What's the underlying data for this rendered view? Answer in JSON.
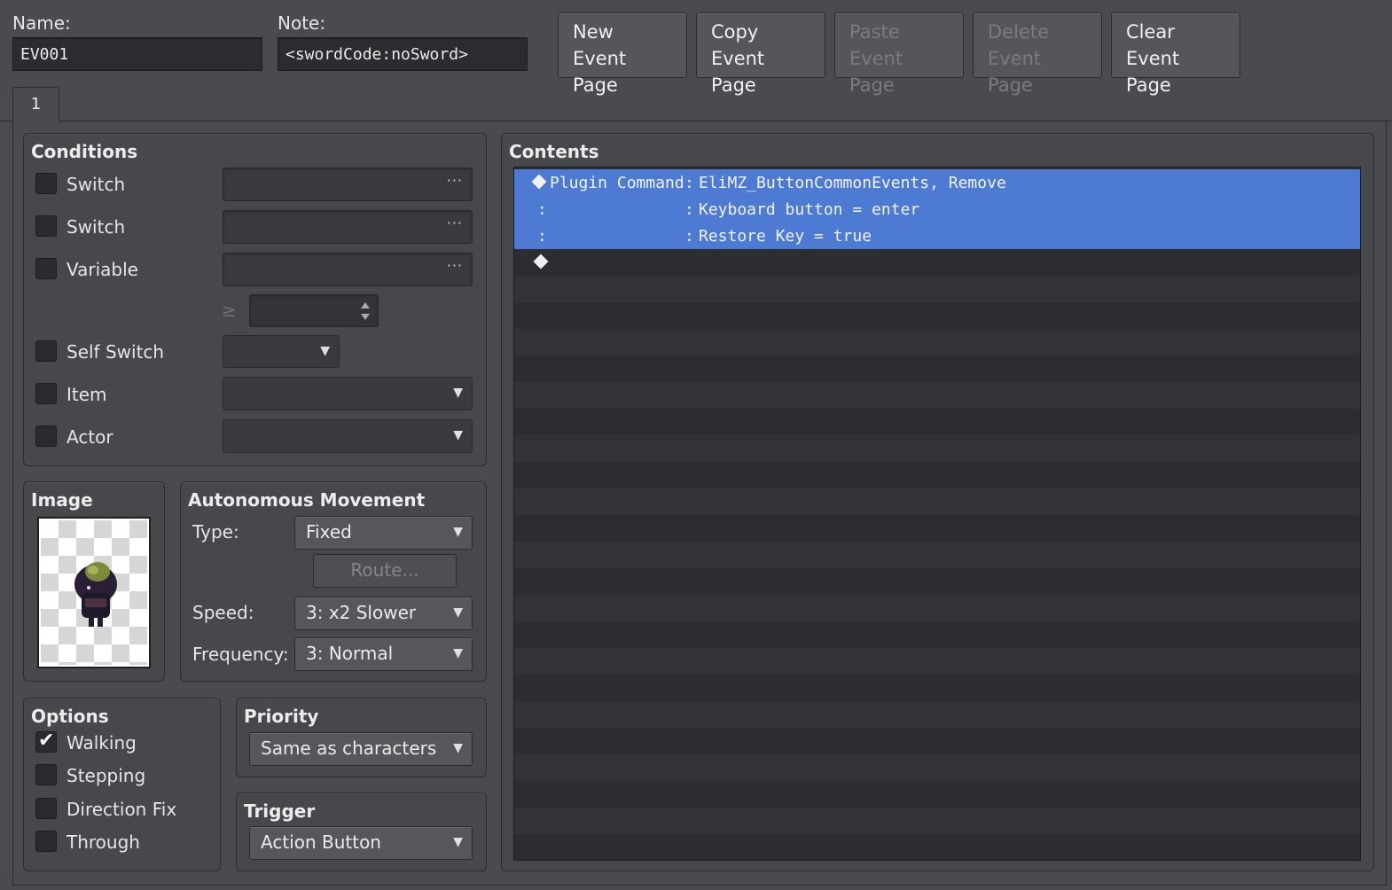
{
  "header": {
    "name_label": "Name:",
    "name_value": "EV001",
    "note_label": "Note:",
    "note_value": "<swordCode:noSword>",
    "buttons": [
      {
        "line1": "New",
        "line2": "Event Page",
        "enabled": true
      },
      {
        "line1": "Copy",
        "line2": "Event Page",
        "enabled": true
      },
      {
        "line1": "Paste",
        "line2": "Event Page",
        "enabled": false
      },
      {
        "line1": "Delete",
        "line2": "Event Page",
        "enabled": false
      },
      {
        "line1": "Clear",
        "line2": "Event Page",
        "enabled": true
      }
    ]
  },
  "tabs": [
    {
      "label": "1",
      "active": true
    }
  ],
  "conditions": {
    "title": "Conditions",
    "switch1_label": "Switch",
    "switch2_label": "Switch",
    "variable_label": "Variable",
    "ellipsis": "···",
    "compare_symbol": "≥",
    "self_switch_label": "Self Switch",
    "item_label": "Item",
    "actor_label": "Actor"
  },
  "image": {
    "title": "Image"
  },
  "movement": {
    "title": "Autonomous Movement",
    "type_label": "Type:",
    "type_value": "Fixed",
    "route_button": "Route...",
    "speed_label": "Speed:",
    "speed_value": "3: x2 Slower",
    "frequency_label": "Frequency:",
    "frequency_value": "3: Normal"
  },
  "options": {
    "title": "Options",
    "walking": "Walking",
    "walking_checked": true,
    "stepping": "Stepping",
    "direction_fix": "Direction Fix",
    "through": "Through"
  },
  "priority": {
    "title": "Priority",
    "value": "Same as characters"
  },
  "trigger": {
    "title": "Trigger",
    "value": "Action Button"
  },
  "contents": {
    "title": "Contents",
    "lines": [
      {
        "prefix": "Plugin Command",
        "sep": ":",
        "text": "EliMZ_ButtonCommonEvents, Remove"
      },
      {
        "prefix": ":",
        "sep": ":",
        "text": "Keyboard button = enter"
      },
      {
        "prefix": ":",
        "sep": ":",
        "text": "Restore Key = true"
      }
    ]
  },
  "colors": {
    "background": "#4a4b4e",
    "selection": "#4d7ad3",
    "list_bg": "#2c2d30"
  },
  "icons": {
    "dropdown": "chevron-down-icon",
    "ellipsis": "ellipsis-icon",
    "spinner": "spinner-arrows-icon",
    "diamond": "diamond-icon"
  }
}
